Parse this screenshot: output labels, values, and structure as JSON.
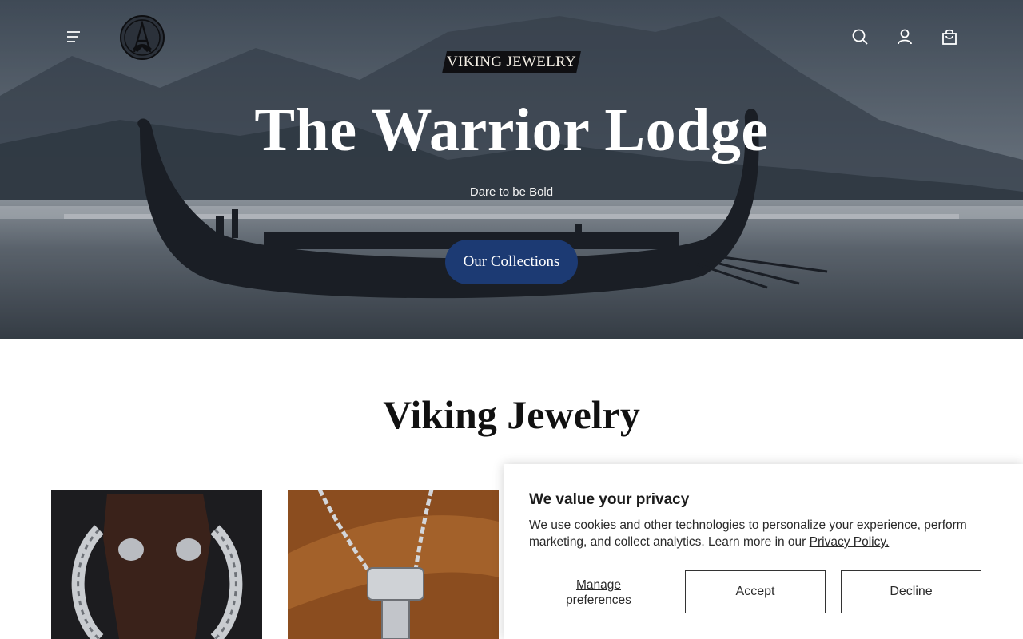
{
  "header": {
    "icons": [
      "menu-icon",
      "logo",
      "search-icon",
      "account-icon",
      "cart-icon"
    ]
  },
  "hero": {
    "eyebrow": "VIKING JEWELRY",
    "title": "The Warrior Lodge",
    "subtitle": "Dare to be Bold",
    "cta_label": "Our Collections"
  },
  "section": {
    "title": "Viking Jewelry"
  },
  "products": [
    {
      "image": "silver wolf-head torc bracelet"
    },
    {
      "image": "silver hammer pendant on chain"
    }
  ],
  "cookie_banner": {
    "title": "We value your privacy",
    "body": "We use cookies and other technologies to personalize your experience, perform marketing, and collect analytics. Learn more in our",
    "link_label": "Privacy Policy.",
    "manage_label": "Manage preferences",
    "accept_label": "Accept",
    "decline_label": "Decline"
  },
  "colors": {
    "cta": "#1c3a73",
    "eyebrow_bg": "#0f0f12",
    "text": "#111111"
  }
}
